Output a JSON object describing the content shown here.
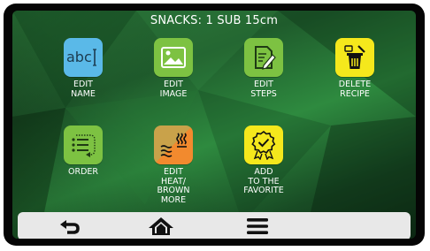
{
  "header": {
    "title": "SNACKS: 1 SUB 15cm"
  },
  "tiles": [
    {
      "label": "EDIT\nNAME",
      "icon": "abc-text-icon",
      "icon_text": "abc",
      "color": "#5ab9e8"
    },
    {
      "label": "EDIT\nIMAGE",
      "icon": "image-icon",
      "color": "#7dc242"
    },
    {
      "label": "EDIT\nSTEPS",
      "icon": "steps-edit-icon",
      "color": "#7dc242"
    },
    {
      "label": "DELETE\nRECIPE",
      "icon": "trash-icon",
      "color": "#f5e81c"
    },
    {
      "label": "ORDER",
      "icon": "order-list-icon",
      "color": "#7dc242"
    },
    {
      "label": "EDIT\nHEAT/\nBROWN MORE",
      "icon": "heat-brown-icon",
      "color_left": "#c9a24a",
      "color_right": "#f28a2e"
    },
    {
      "label": "ADD\nTO THE\nFAVORITE",
      "icon": "favorite-badge-icon",
      "color": "#f5e81c"
    }
  ],
  "bottom_bar": {
    "back": "back-arrow-icon",
    "home": "home-icon",
    "menu": "menu-icon"
  }
}
